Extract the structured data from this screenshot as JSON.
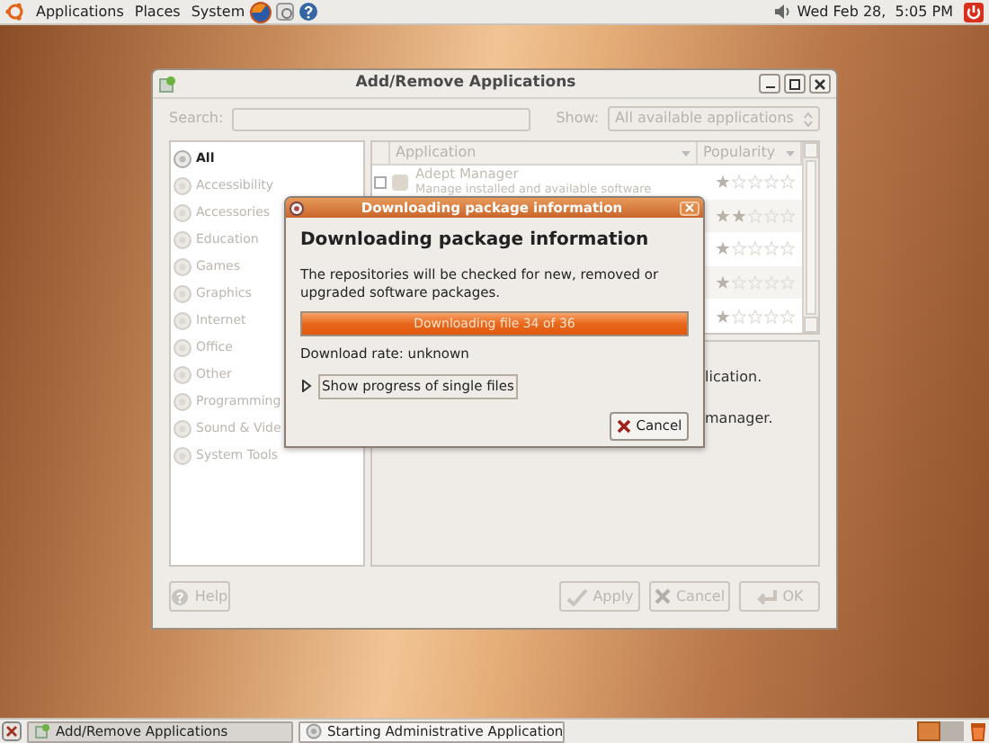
{
  "top_panel": {
    "menus": [
      {
        "label": "Applications"
      },
      {
        "label": "Places"
      },
      {
        "label": "System"
      }
    ],
    "clock": "Wed Feb 28,  5:05 PM"
  },
  "main_window": {
    "title": "Add/Remove Applications",
    "search_label": "Search:",
    "show_label": "Show:",
    "show_value": "All available applications",
    "categories": [
      {
        "label": "All",
        "selected": true
      },
      {
        "label": "Accessibility",
        "selected": false
      },
      {
        "label": "Accessories",
        "selected": false
      },
      {
        "label": "Education",
        "selected": false
      },
      {
        "label": "Games",
        "selected": false
      },
      {
        "label": "Graphics",
        "selected": false
      },
      {
        "label": "Internet",
        "selected": false
      },
      {
        "label": "Office",
        "selected": false
      },
      {
        "label": "Other",
        "selected": false
      },
      {
        "label": "Programming",
        "selected": false
      },
      {
        "label": "Sound & Vide",
        "selected": false
      },
      {
        "label": "System Tools",
        "selected": false
      }
    ],
    "columns": [
      {
        "label": "Application"
      },
      {
        "label": "Popularity"
      }
    ],
    "rows": [
      {
        "checked": false,
        "name": "Adept Manager",
        "description": "Manage installed and available software",
        "stars": 1
      },
      {
        "stars": 2
      },
      {
        "stars": 1
      },
      {
        "stars": 1
      },
      {
        "stars": 1
      }
    ],
    "description_lines": [
      "lication.",
      "manager."
    ],
    "buttons": [
      {
        "kind": "help",
        "label": "Help"
      },
      {
        "kind": "apply",
        "label": "Apply"
      },
      {
        "kind": "cancel",
        "label": "Cancel"
      },
      {
        "kind": "ok",
        "label": "OK"
      }
    ]
  },
  "dialog": {
    "title": "Downloading package information",
    "heading": "Downloading package information",
    "message": "The repositories will be checked for new, removed or upgraded software packages.",
    "progress": {
      "level": 1,
      "text": "Downloading file 34 of 36"
    },
    "rate": "Download rate: unknown",
    "expander": {
      "label": "Show progress of single files",
      "expanded": false
    },
    "cancel": "Cancel"
  },
  "taskbar": {
    "tasks": [
      {
        "label": "Add/Remove Applications",
        "selected": true
      },
      {
        "label": "Starting Administrative Application",
        "selected": false
      }
    ]
  }
}
